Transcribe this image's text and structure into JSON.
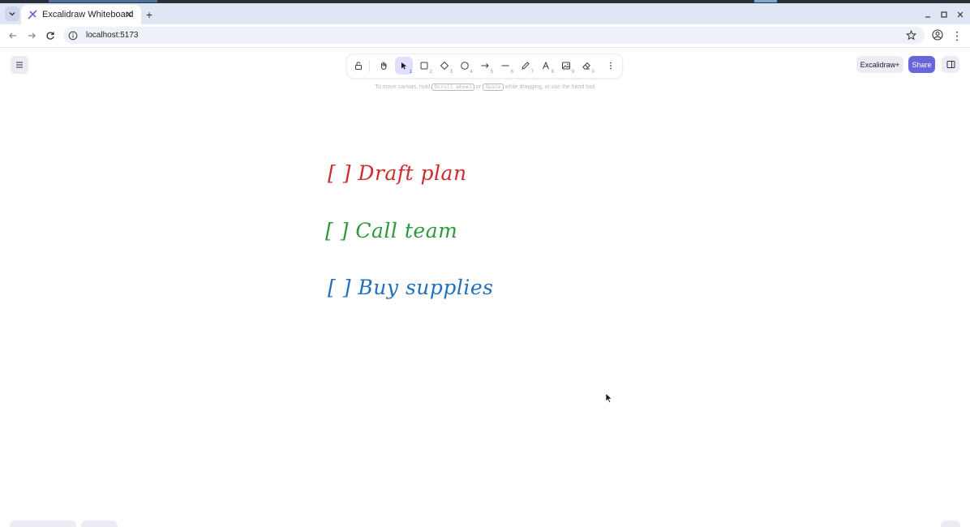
{
  "browser": {
    "tab_title": "Excalidraw Whiteboard",
    "new_tab_label": "+",
    "url": "localhost:5173",
    "tab_close_label": "✕"
  },
  "app": {
    "toolbar": {
      "tools": [
        {
          "id": "lock",
          "key": ""
        },
        {
          "id": "hand",
          "key": ""
        },
        {
          "id": "selection",
          "key": "1"
        },
        {
          "id": "rectangle",
          "key": "2"
        },
        {
          "id": "diamond",
          "key": "3"
        },
        {
          "id": "ellipse",
          "key": "4"
        },
        {
          "id": "arrow",
          "key": "5"
        },
        {
          "id": "line",
          "key": "6"
        },
        {
          "id": "draw",
          "key": "7"
        },
        {
          "id": "text",
          "key": "8"
        },
        {
          "id": "image",
          "key": "9"
        },
        {
          "id": "eraser",
          "key": "0"
        }
      ],
      "active_tool": "selection"
    },
    "hint": {
      "before": "To move canvas, hold",
      "key1": "Scroll wheel",
      "or": "or",
      "key2": "Space",
      "after": "while dragging, or use the hand tool"
    },
    "excalidraw_plus_label": "Excalidraw+",
    "share_label": "Share",
    "accent_color": "#6965db"
  },
  "canvas": {
    "items": [
      {
        "text": "[ ] Draft plan",
        "color": "#d02a2a"
      },
      {
        "text": "[ ] Call team",
        "color": "#2c9a3a"
      },
      {
        "text": "[ ] Buy supplies",
        "color": "#1f6fbf"
      }
    ]
  }
}
